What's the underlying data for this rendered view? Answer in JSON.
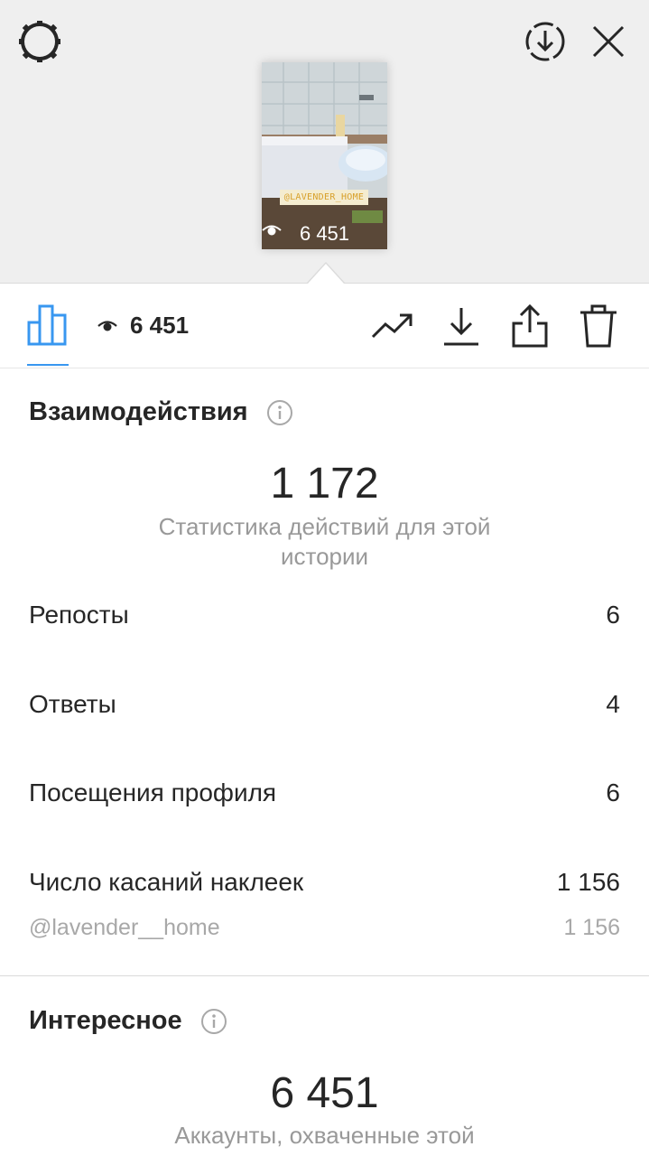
{
  "story": {
    "sticker_text": "@LAVENDER_HOME",
    "views": "6 451"
  },
  "toolbar": {
    "views": "6 451"
  },
  "interactions": {
    "title": "Взаимодействия",
    "total": "1 172",
    "caption": "Статистика действий для этой истории",
    "rows": [
      {
        "label": "Репосты",
        "value": "6"
      },
      {
        "label": "Ответы",
        "value": "4"
      },
      {
        "label": "Посещения профиля",
        "value": "6"
      },
      {
        "label": "Число касаний наклеек",
        "value": "1 156"
      }
    ],
    "sticker_row": {
      "label": "@lavender__home",
      "value": "1 156"
    }
  },
  "discovery": {
    "title": "Интересное",
    "total": "6 451",
    "caption": "Аккаунты, охваченные этой"
  },
  "icons": {
    "settings": "settings-gear-icon",
    "download_circle": "download-circle-icon",
    "close": "close-icon",
    "stats": "bar-chart-icon",
    "eye": "eye-icon",
    "trend": "trend-up-icon",
    "download": "download-icon",
    "share": "share-icon",
    "trash": "trash-icon",
    "info": "info-icon"
  },
  "colors": {
    "accent": "#3897f0",
    "muted_text": "#999999",
    "top_bg": "#efefef"
  }
}
